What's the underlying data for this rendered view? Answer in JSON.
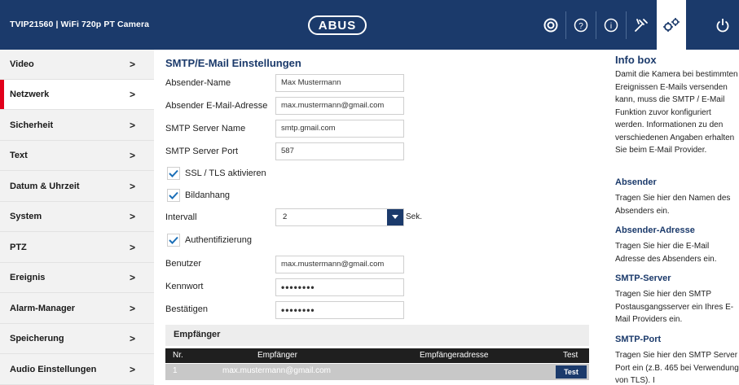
{
  "header": {
    "model": "TVIP21560 | WiFi 720p PT Camera",
    "logo": "ABUS",
    "icons": [
      "live-view-icon",
      "help-icon",
      "info-icon",
      "tools-icon",
      "settings-icon",
      "power-icon"
    ]
  },
  "sidebar": {
    "items": [
      {
        "label": "Video",
        "arrow": ">"
      },
      {
        "label": "Netzwerk",
        "arrow": ">"
      },
      {
        "label": "Sicherheit",
        "arrow": ">"
      },
      {
        "label": "Text",
        "arrow": ">"
      },
      {
        "label": "Datum & Uhrzeit",
        "arrow": ">"
      },
      {
        "label": "System",
        "arrow": ">"
      },
      {
        "label": "PTZ",
        "arrow": ">"
      },
      {
        "label": "Ereignis",
        "arrow": ">"
      },
      {
        "label": "Alarm-Manager",
        "arrow": ">"
      },
      {
        "label": "Speicherung",
        "arrow": ">"
      },
      {
        "label": "Audio Einstellungen",
        "arrow": ">"
      }
    ]
  },
  "form": {
    "title": "SMTP/E-Mail Einstellungen",
    "sender_name": {
      "label": "Absender-Name",
      "value": "Max Mustermann"
    },
    "sender_email": {
      "label": "Absender E-Mail-Adresse",
      "value": "max.mustermann@gmail.com"
    },
    "smtp_server": {
      "label": "SMTP Server Name",
      "value": "smtp.gmail.com"
    },
    "smtp_port": {
      "label": "SMTP Server Port",
      "value": "587"
    },
    "ssl": {
      "label": "SSL / TLS aktivieren",
      "checked": true
    },
    "attachment": {
      "label": "Bildanhang",
      "checked": true
    },
    "interval": {
      "label": "Intervall",
      "value": "2",
      "unit": "Sek."
    },
    "auth": {
      "label": "Authentifizierung",
      "checked": true
    },
    "user": {
      "label": "Benutzer",
      "value": "max.mustermann@gmail.com"
    },
    "password": {
      "label": "Kennwort",
      "value": "••••••••"
    },
    "confirm": {
      "label": "Bestätigen",
      "value": "••••••••"
    }
  },
  "recipients": {
    "title": "Empfänger",
    "columns": [
      "Nr.",
      "Empfänger",
      "Empfängeradresse",
      "Test"
    ],
    "rows": [
      {
        "nr": "1",
        "name": "max.mustermann@gmail.com",
        "address": "",
        "test": "Test"
      }
    ]
  },
  "info": {
    "title": "Info box",
    "intro": "Damit die Kamera bei bestimmten Ereignissen E-Mails versenden kann, muss die SMTP / E-Mail Funktion zuvor konfiguriert werden. Informationen zu den verschiedenen Angaben erhalten Sie beim E-Mail Provider.",
    "sections": [
      {
        "heading": "Absender",
        "text": "Tragen Sie hier den Namen des Absenders ein."
      },
      {
        "heading": "Absender-Adresse",
        "text": "Tragen Sie hier die E-Mail Adresse des Absenders ein."
      },
      {
        "heading": "SMTP-Server",
        "text": "Tragen Sie hier den SMTP Postausgangsserver ein Ihres E-Mail Providers ein."
      },
      {
        "heading": "SMTP-Port",
        "text": "Tragen Sie hier den SMTP Server Port ein (z.B. 465 bei Verwendung von TLS). I"
      }
    ]
  },
  "colors": {
    "navy": "#1b3a6b",
    "accent_red": "#e1001a"
  }
}
